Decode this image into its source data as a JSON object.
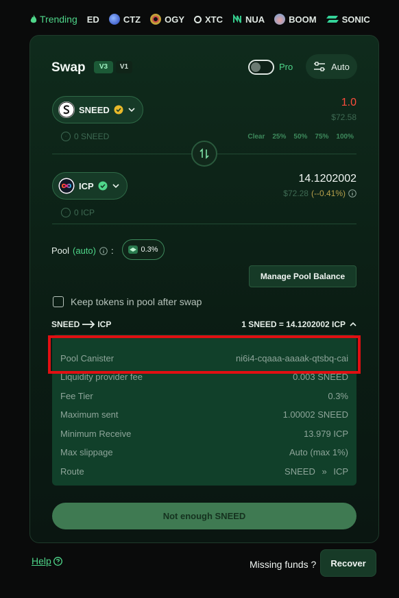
{
  "trending": {
    "label": "Trending",
    "items": [
      {
        "symbol": "ED",
        "icon": "sneed-icon"
      },
      {
        "symbol": "CTZ",
        "icon": "ctz-icon"
      },
      {
        "symbol": "OGY",
        "icon": "ogy-icon"
      },
      {
        "symbol": "XTC",
        "icon": "xtc-icon"
      },
      {
        "symbol": "NUA",
        "icon": "nua-icon"
      },
      {
        "symbol": "BOOM",
        "icon": "boom-icon"
      },
      {
        "symbol": "SONIC",
        "icon": "sonic-icon"
      }
    ]
  },
  "swap": {
    "title": "Swap",
    "version_active": "V3",
    "version_other": "V1",
    "pro_label": "Pro",
    "pro_enabled": false,
    "auto_label": "Auto"
  },
  "from": {
    "token": "SNEED",
    "balance": "0 SNEED",
    "amount": "1.0",
    "usd": "$72.58",
    "percent_buttons": [
      "Clear",
      "25%",
      "50%",
      "75%",
      "100%"
    ]
  },
  "to": {
    "token": "ICP",
    "balance": "0 ICP",
    "amount": "14.1202002",
    "usd": "$72.28",
    "change": "(--0.41%)"
  },
  "pool": {
    "label": "Pool",
    "mode": "(auto)",
    "separator": ":",
    "fee": "0.3%",
    "manage_label": "Manage Pool Balance",
    "keep_label": "Keep tokens in pool after swap"
  },
  "route_summary": {
    "from": "SNEED",
    "to": "ICP",
    "rate": "1 SNEED = 14.1202002 ICP"
  },
  "details": [
    {
      "label": "Pool Canister",
      "value": "ni6i4-cqaaa-aaaak-qtsbq-cai"
    },
    {
      "label": "Liquidity provider fee",
      "value": "0.003 SNEED"
    },
    {
      "label": "Fee Tier",
      "value": "0.3%"
    },
    {
      "label": "Maximum sent",
      "value": "1.00002 SNEED"
    },
    {
      "label": "Minimum Receive",
      "value": "13.979 ICP"
    },
    {
      "label": "Max slippage",
      "value": "Auto (max 1%)"
    },
    {
      "label": "Route",
      "value_from": "SNEED",
      "value_sep": "»",
      "value_to": "ICP"
    }
  ],
  "cta_label": "Not enough SNEED",
  "footer": {
    "help_label": "Help",
    "missing_label": "Missing funds ?",
    "recover_label": "Recover"
  },
  "colors": {
    "accent": "#4fd68a",
    "amount_error": "#ff4d3d",
    "highlight": "#e10f12"
  }
}
